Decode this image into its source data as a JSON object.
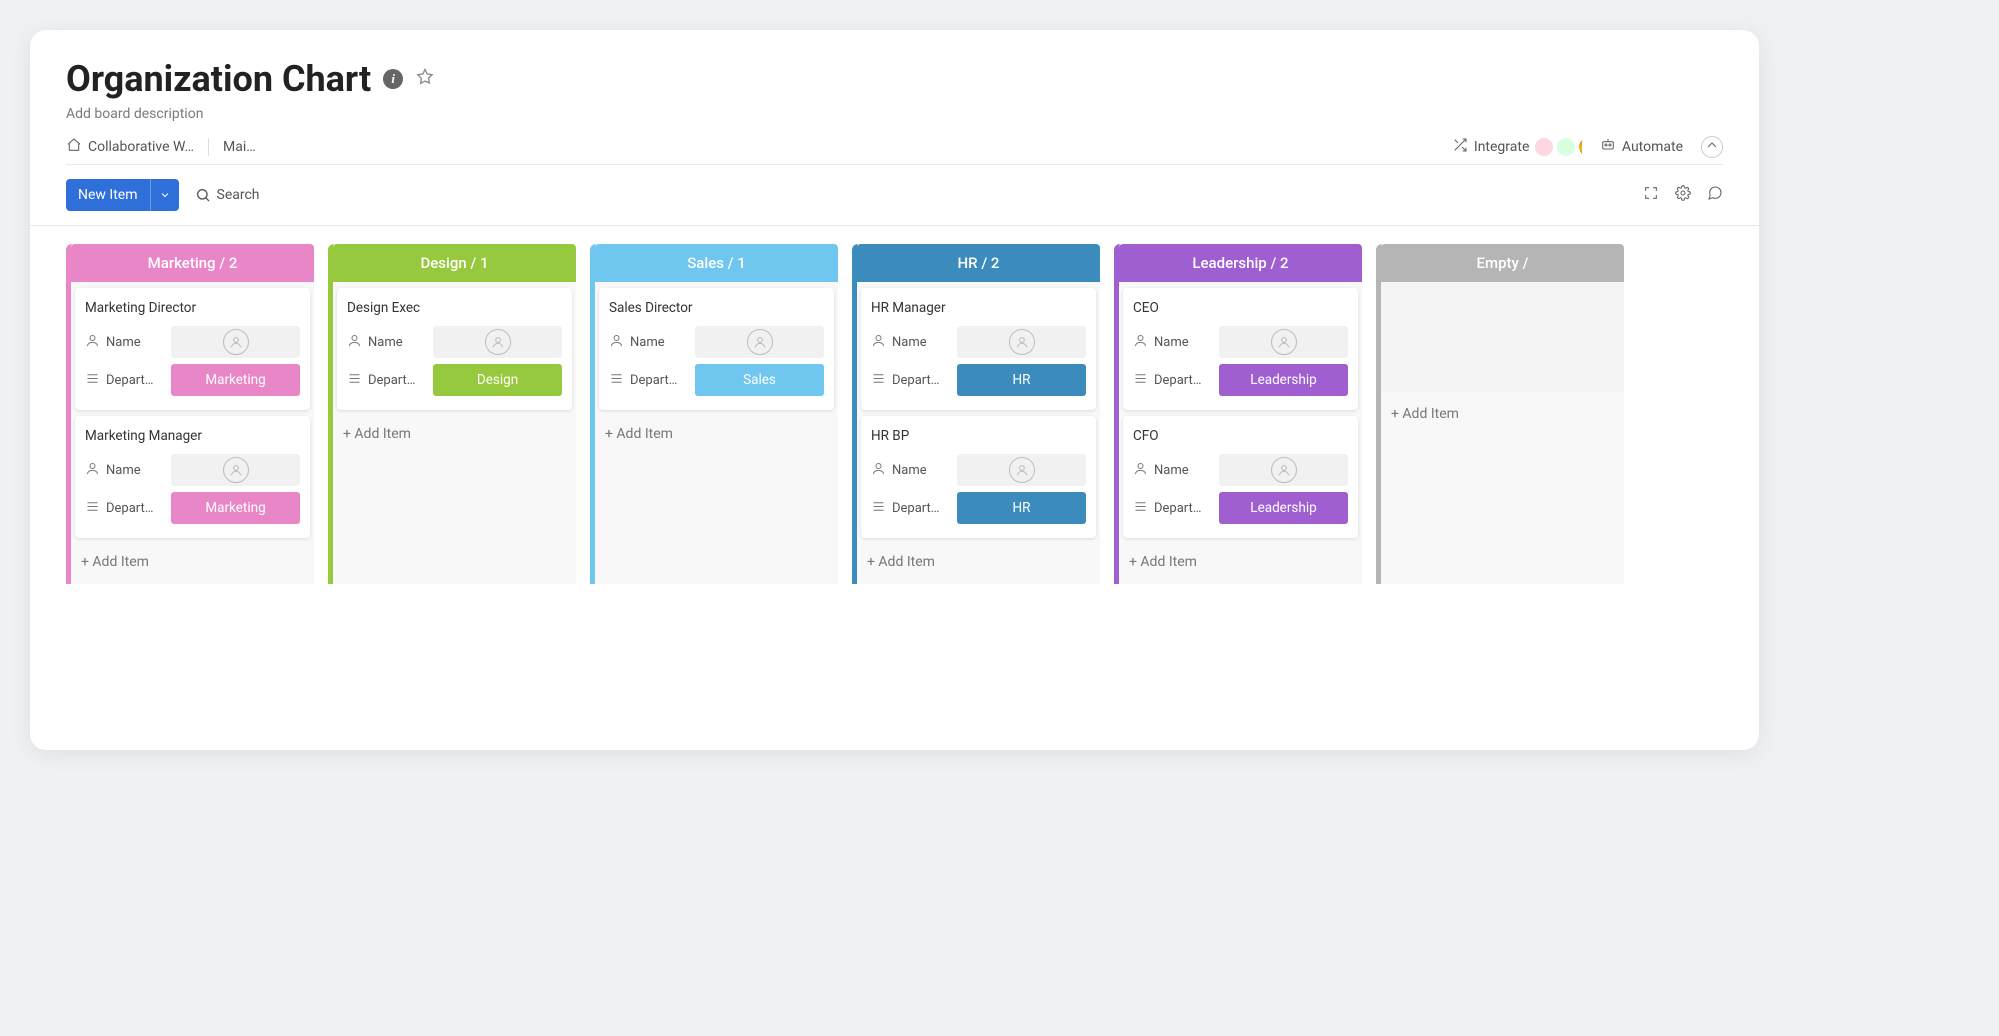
{
  "header": {
    "title": "Organization Chart",
    "description": "Add board description",
    "breadcrumb_workspace": "Collaborative W…",
    "breadcrumb_view": "Mai…",
    "integrate_label": "Integrate",
    "automate_label": "Automate"
  },
  "toolbar": {
    "new_item_label": "New Item",
    "search_label": "Search"
  },
  "labels": {
    "name": "Name",
    "department": "Depart…",
    "add_item": "+ Add Item"
  },
  "columns": [
    {
      "title": "Marketing / 2",
      "header_color": "#e986c7",
      "border_color": "#e986c7",
      "cards": [
        {
          "title": "Marketing Director",
          "dept_label": "Marketing",
          "dept_color": "#e986c7"
        },
        {
          "title": "Marketing Manager",
          "dept_label": "Marketing",
          "dept_color": "#e986c7"
        }
      ]
    },
    {
      "title": "Design / 1",
      "header_color": "#96c93d",
      "border_color": "#96c93d",
      "cards": [
        {
          "title": "Design Exec",
          "dept_label": "Design",
          "dept_color": "#96c93d"
        }
      ]
    },
    {
      "title": "Sales / 1",
      "header_color": "#6fc7ef",
      "border_color": "#6fc7ef",
      "cards": [
        {
          "title": "Sales Director",
          "dept_label": "Sales",
          "dept_color": "#6fc7ef"
        }
      ]
    },
    {
      "title": "HR / 2",
      "header_color": "#3c8bbd",
      "border_color": "#3c8bbd",
      "cards": [
        {
          "title": "HR Manager",
          "dept_label": "HR",
          "dept_color": "#3c8bbd"
        },
        {
          "title": "HR BP",
          "dept_label": "HR",
          "dept_color": "#3c8bbd"
        }
      ]
    },
    {
      "title": "Leadership / 2",
      "header_color": "#a05fd1",
      "border_color": "#a05fd1",
      "cards": [
        {
          "title": "CEO",
          "dept_label": "Leadership",
          "dept_color": "#a05fd1"
        },
        {
          "title": "CFO",
          "dept_label": "Leadership",
          "dept_color": "#a05fd1"
        }
      ]
    },
    {
      "title": "Empty /",
      "header_color": "#b5b5b5",
      "border_color": "#b5b5b5",
      "cards": [],
      "empty": true
    }
  ]
}
